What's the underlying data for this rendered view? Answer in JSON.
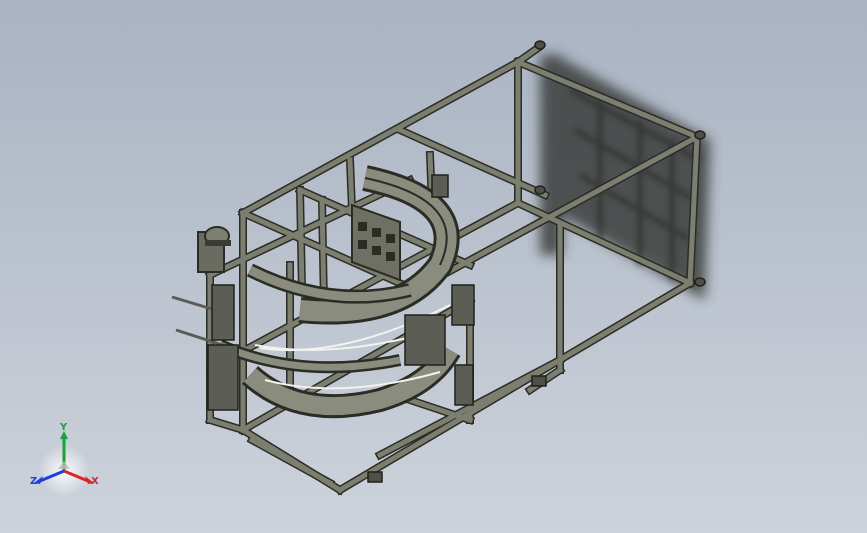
{
  "viewport": {
    "background_top": "#a9b3c2",
    "background_bottom": "#cdd3db"
  },
  "model": {
    "frame_color": "#7c7e70",
    "edge_color": "#2b2c25",
    "shadow_color": "#3a3c3a"
  },
  "triad": {
    "x_label": "X",
    "y_label": "Y",
    "z_label": "Z",
    "x_color": "#d8262a",
    "y_color": "#18a33a",
    "z_color": "#1f3fd6"
  }
}
